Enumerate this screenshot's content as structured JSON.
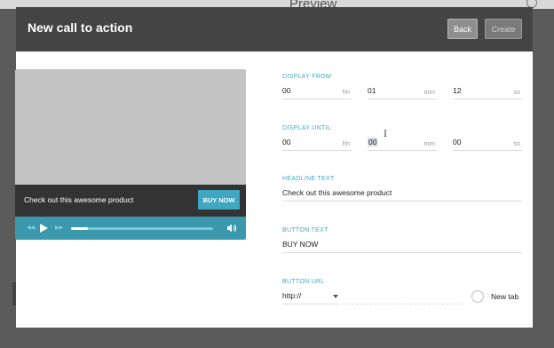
{
  "background": {
    "title": "Preview"
  },
  "modal": {
    "title": "New call to action",
    "back_label": "Back",
    "create_label": "Create"
  },
  "preview": {
    "cta_text": "Check out this awesome product",
    "cta_button": "BUY NOW",
    "progress": 0.12
  },
  "form": {
    "display_from": {
      "label": "DISPLAY FROM",
      "hh": "00",
      "hh_unit": "hh",
      "mm": "01",
      "mm_unit": "mm",
      "ss": "12",
      "ss_unit": "ss"
    },
    "display_until": {
      "label": "DISPLAY UNTIL",
      "hh": "00",
      "hh_unit": "hh",
      "mm": "00",
      "mm_unit": "mm",
      "ss": "00",
      "ss_unit": "ss"
    },
    "headline": {
      "label": "HEADLINE TEXT",
      "value": "Check out this awesome product"
    },
    "button_text": {
      "label": "BUTTON TEXT",
      "value": "BUY NOW"
    },
    "button_url": {
      "label": "BUTTON URL",
      "protocol": "http://",
      "value": ""
    },
    "new_tab_label": "New tab"
  },
  "icons": [
    "play-icon",
    "prev-icon",
    "next-icon",
    "volume-icon",
    "text-cursor-icon",
    "dropdown-caret-icon"
  ],
  "colors": {
    "accent": "#3fa7c2",
    "header": "#444444",
    "player_bar": "#3b98ad"
  }
}
